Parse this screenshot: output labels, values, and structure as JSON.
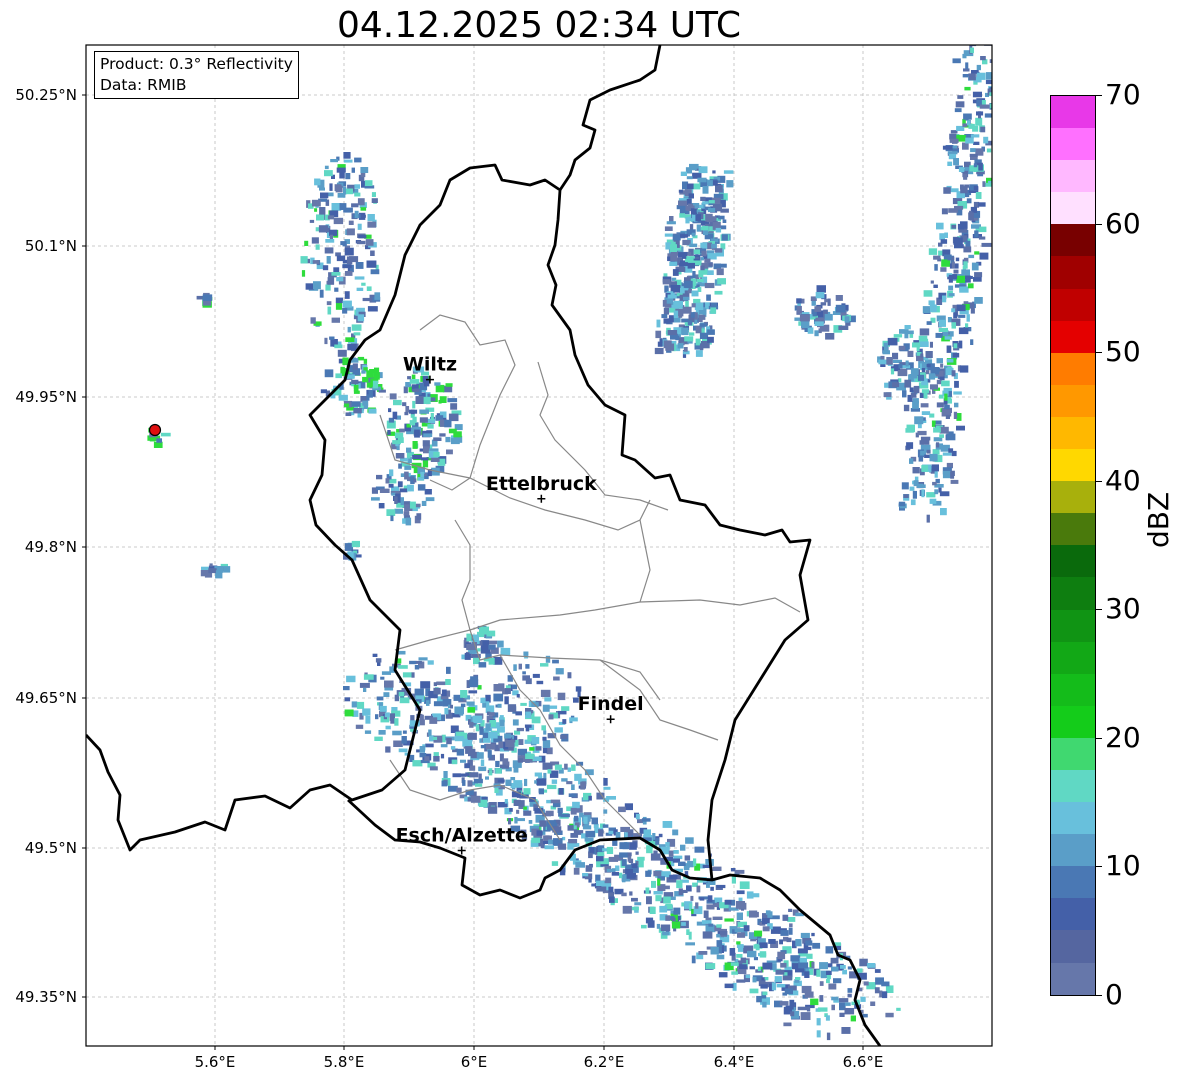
{
  "title": "04.12.2025 02:34 UTC",
  "info": {
    "product": "Product: 0.3° Reflectivity",
    "data": "Data: RMIB"
  },
  "axes": {
    "lat_labels": [
      "50.25°N",
      "50.1°N",
      "49.95°N",
      "49.8°N",
      "49.65°N",
      "49.5°N",
      "49.35°N"
    ],
    "lon_labels": [
      "5.6°E",
      "5.8°E",
      "6°E",
      "6.2°E",
      "6.4°E",
      "6.6°E"
    ]
  },
  "cities": [
    {
      "name": "Wiltz",
      "lat": 49.966,
      "lon": 5.932
    },
    {
      "name": "Ettelbruck",
      "lat": 49.847,
      "lon": 6.104
    },
    {
      "name": "Findel",
      "lat": 49.627,
      "lon": 6.211
    },
    {
      "name": "Esch/Alzette",
      "lat": 49.496,
      "lon": 5.981
    }
  ],
  "colorbar": {
    "title": "dBZ",
    "tick_labels": [
      "0",
      "10",
      "20",
      "30",
      "40",
      "50",
      "60",
      "70"
    ],
    "colors": [
      "#6677aa",
      "#5566a0",
      "#4460a8",
      "#4a78b4",
      "#5a9ec8",
      "#68c0dc",
      "#60d8c4",
      "#40d870",
      "#14cc1a",
      "#14bc1a",
      "#12a816",
      "#109414",
      "#0e7e10",
      "#0a6a0c",
      "#4a7a0c",
      "#a8b00c",
      "#ffd800",
      "#ffb800",
      "#ff9800",
      "#ff7c00",
      "#e40000",
      "#c00000",
      "#a00000",
      "#780000",
      "#ffe0ff",
      "#ffb8ff",
      "#ff70ff",
      "#e838e8"
    ]
  }
}
